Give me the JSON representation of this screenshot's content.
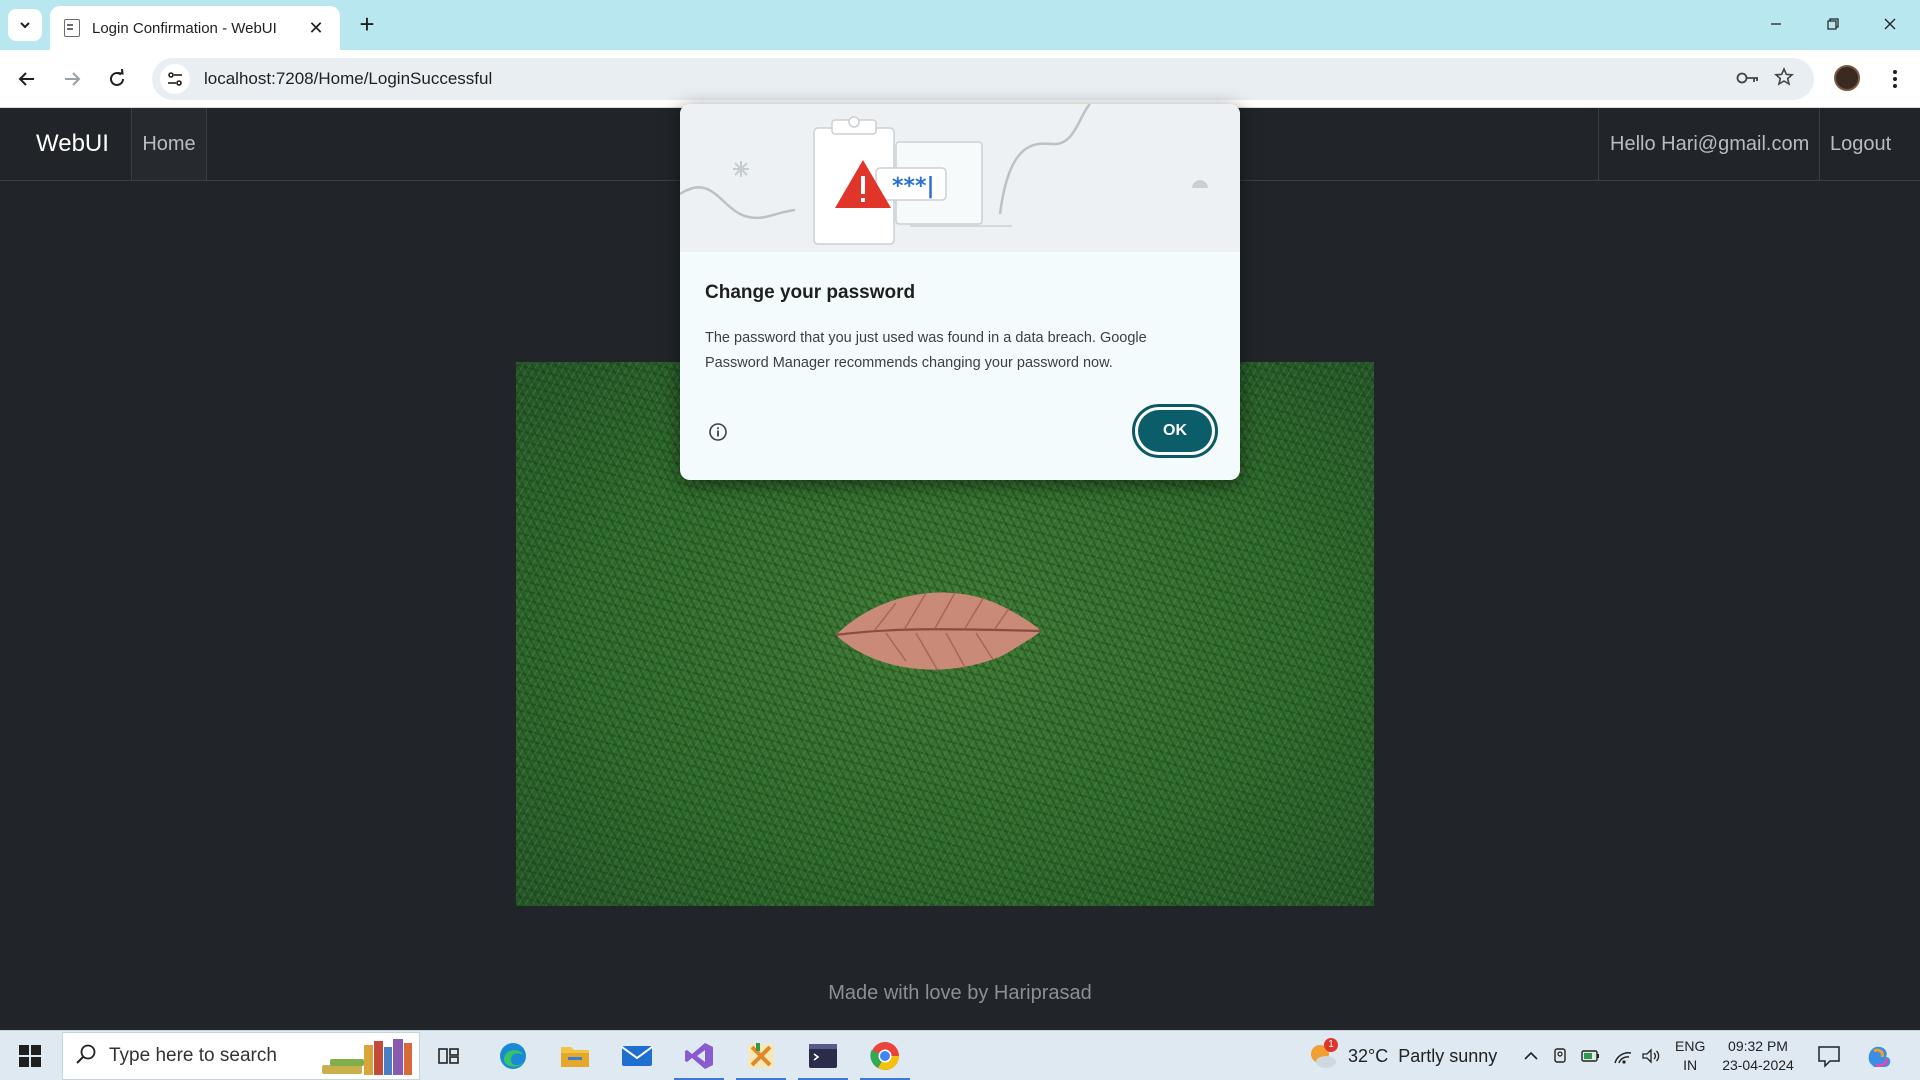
{
  "browser": {
    "tab_title": "Login Confirmation - WebUI",
    "tab_close_glyph": "✕",
    "new_tab_glyph": "+",
    "url": "localhost:7208/Home/LoginSuccessful",
    "icons": [
      "tab-search-icon",
      "favicon-icon",
      "back-icon",
      "forward-icon",
      "reload-icon",
      "site-info-icon",
      "password-key-icon",
      "bookmark-star-icon",
      "profile-avatar",
      "kebab-menu-icon",
      "minimize-icon",
      "restore-icon",
      "close-icon"
    ]
  },
  "navbar": {
    "brand": "WebUI",
    "home": "Home",
    "greeting": "Hello Hari@gmail.com",
    "logout": "Logout"
  },
  "dialog": {
    "title": "Change your password",
    "body": "The password that you just used was found in a data breach. Google Password Manager recommends changing your password now.",
    "ok_label": "OK",
    "illustration_text": "***|"
  },
  "footer": {
    "text": "Made with love by Hariprasad"
  },
  "taskbar": {
    "search_placeholder": "Type here to search",
    "weather": "32°C  Partly sunny",
    "weather_badge": "1",
    "lang_top": "ENG",
    "lang_bottom": "IN",
    "time": "09:32 PM",
    "date": "23-04-2024",
    "apps": [
      "task-view",
      "edge",
      "file-explorer",
      "mail",
      "visual-studio",
      "xl-app",
      "terminal",
      "chrome"
    ]
  },
  "colors": {
    "page_bg": "#212529",
    "tabstrip": "#b9e7ef",
    "ok_button": "#0b5d6a",
    "taskbar": "#dfe9f2"
  }
}
